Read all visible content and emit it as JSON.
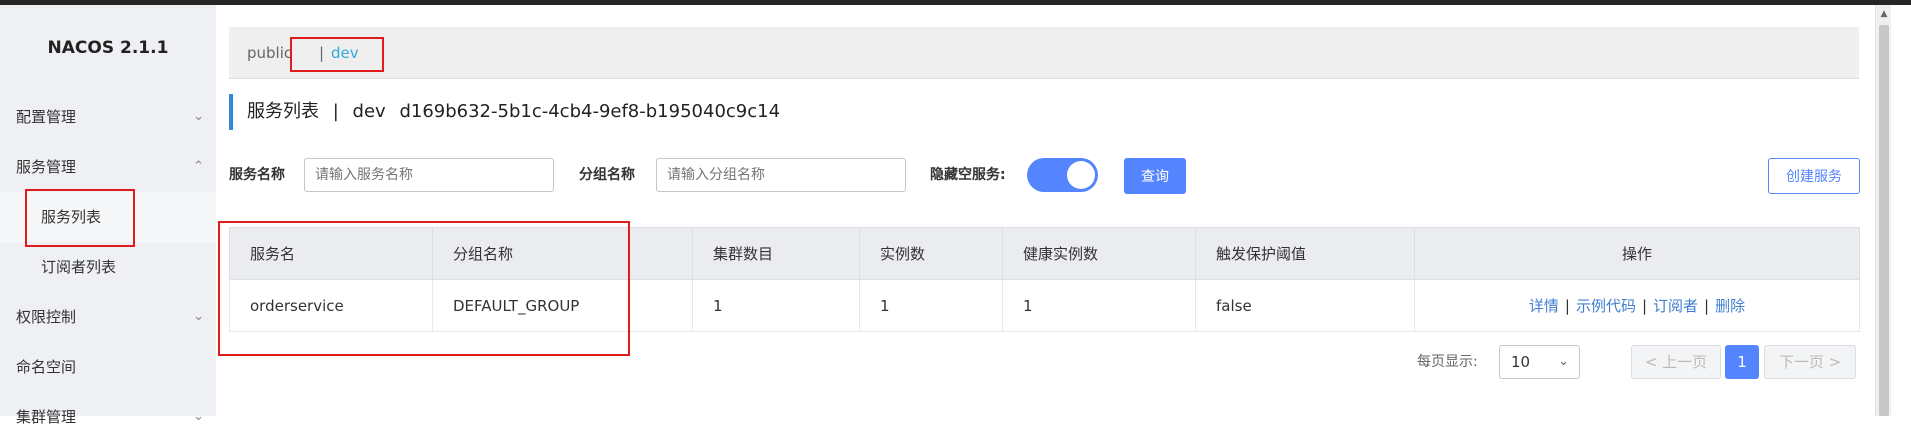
{
  "sidebar": {
    "brand": "NACOS 2.1.1",
    "items": [
      {
        "label": "配置管理",
        "chevron": "chevron-down-icon"
      },
      {
        "label": "服务管理",
        "chevron": "chevron-up-icon"
      },
      {
        "label": "服务列表",
        "sub": true,
        "active": true
      },
      {
        "label": "订阅者列表",
        "sub": true
      },
      {
        "label": "权限控制",
        "chevron": "chevron-down-icon"
      },
      {
        "label": "命名空间"
      },
      {
        "label": "集群管理",
        "chevron": "chevron-down-icon"
      }
    ]
  },
  "namespaces": {
    "public": "public",
    "separator": "|",
    "dev": "dev"
  },
  "page": {
    "title": "服务列表",
    "title_sep": "|",
    "namespace_name": "dev",
    "namespace_id": "d169b632-5b1c-4cb4-9ef8-b195040c9c14"
  },
  "filters": {
    "service_name_label": "服务名称",
    "service_name_placeholder": "请输入服务名称",
    "group_name_label": "分组名称",
    "group_name_placeholder": "请输入分组名称",
    "hide_empty_label": "隐藏空服务:",
    "hide_empty_on": true,
    "query_button": "查询",
    "create_button": "创建服务"
  },
  "table": {
    "headers": [
      "服务名",
      "分组名称",
      "集群数目",
      "实例数",
      "健康实例数",
      "触发保护阈值",
      "操作"
    ],
    "rows": [
      {
        "service": "orderservice",
        "group": "DEFAULT_GROUP",
        "clusters": "1",
        "instances": "1",
        "healthy": "1",
        "threshold": "false",
        "ops": [
          "详情",
          "示例代码",
          "订阅者",
          "删除"
        ]
      }
    ]
  },
  "pagination": {
    "page_size_label": "每页显示:",
    "page_size": "10",
    "prev": "上一页",
    "current": "1",
    "next": "下一页"
  },
  "colors": {
    "accent": "#5584ff",
    "link": "#3f7fd1",
    "annotation": "#e01c1c"
  }
}
